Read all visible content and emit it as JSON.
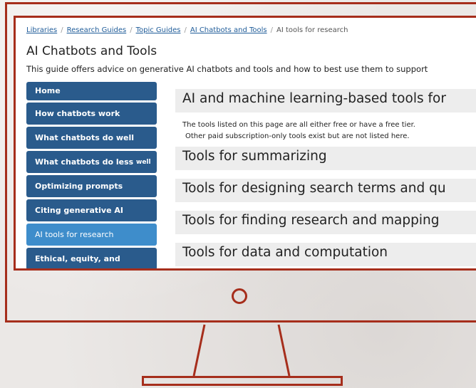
{
  "breadcrumb": {
    "items": [
      "Libraries",
      "Research Guides",
      "Topic Guides",
      "AI Chatbots and Tools"
    ],
    "current": "AI tools for research",
    "separator": "/"
  },
  "guide": {
    "title": "AI Chatbots and Tools",
    "description": "This guide offers advice on generative AI chatbots and tools and how to best use them to support"
  },
  "sidenav": {
    "items": [
      {
        "label": "Home"
      },
      {
        "label": "How chatbots work"
      },
      {
        "label": "What chatbots do well"
      },
      {
        "label": "What chatbots do less",
        "label_small": "well"
      },
      {
        "label": "Optimizing prompts"
      },
      {
        "label": "Citing generative AI"
      },
      {
        "label": "AI tools for research",
        "active": true
      },
      {
        "label": "Ethical, equity, and"
      }
    ]
  },
  "main": {
    "heading": "AI and machine learning-based tools for",
    "intro_line1": "The tools listed on this page are all either free or have a free tier.",
    "intro_line2": "Other paid subscription-only tools exist but are not listed here.",
    "sections": [
      "Tools for summarizing",
      "Tools for designing search terms and qu",
      "Tools for finding research and mapping",
      "Tools for data and computation"
    ]
  },
  "colors": {
    "frame": "#a62e1c",
    "nav": "#2a5b8c",
    "nav_active": "#3e8dcb",
    "link": "#1f5c99",
    "box": "#ededed"
  },
  "icons": {
    "power": "power-button-circle"
  }
}
